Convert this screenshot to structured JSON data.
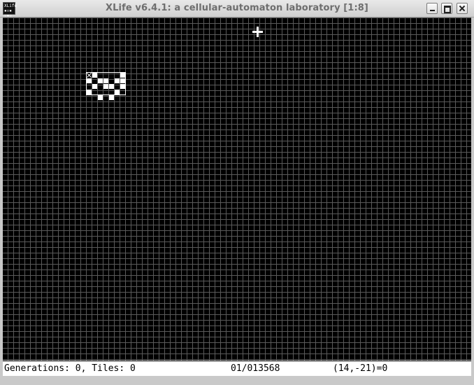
{
  "window": {
    "title": "XLife v6.4.1: a cellular-automaton laboratory [1:8]",
    "icon_name": "xlife-app-icon",
    "icon_text": [
      "XLife",
      "▪▫▪",
      "▫▪▫"
    ],
    "controls": [
      "minimize-icon",
      "maximize-icon",
      "close-icon"
    ]
  },
  "board": {
    "background": "#000000",
    "grid_color": "#5a5a5a",
    "cell_color": "#ffffff",
    "scale": "1:8",
    "live_cells": [
      [
        1,
        0
      ],
      [
        6,
        0
      ],
      [
        0,
        1
      ],
      [
        2,
        1
      ],
      [
        3,
        1
      ],
      [
        5,
        1
      ],
      [
        6,
        1
      ],
      [
        1,
        2
      ],
      [
        3,
        2
      ],
      [
        4,
        2
      ],
      [
        6,
        2
      ],
      [
        0,
        3
      ],
      [
        5,
        3
      ],
      [
        2,
        4
      ],
      [
        4,
        4
      ]
    ]
  },
  "status": {
    "generations": "Generations: 0, Tiles: 0",
    "rule": "01/013568",
    "coordinates": "(14,-21)=0"
  }
}
